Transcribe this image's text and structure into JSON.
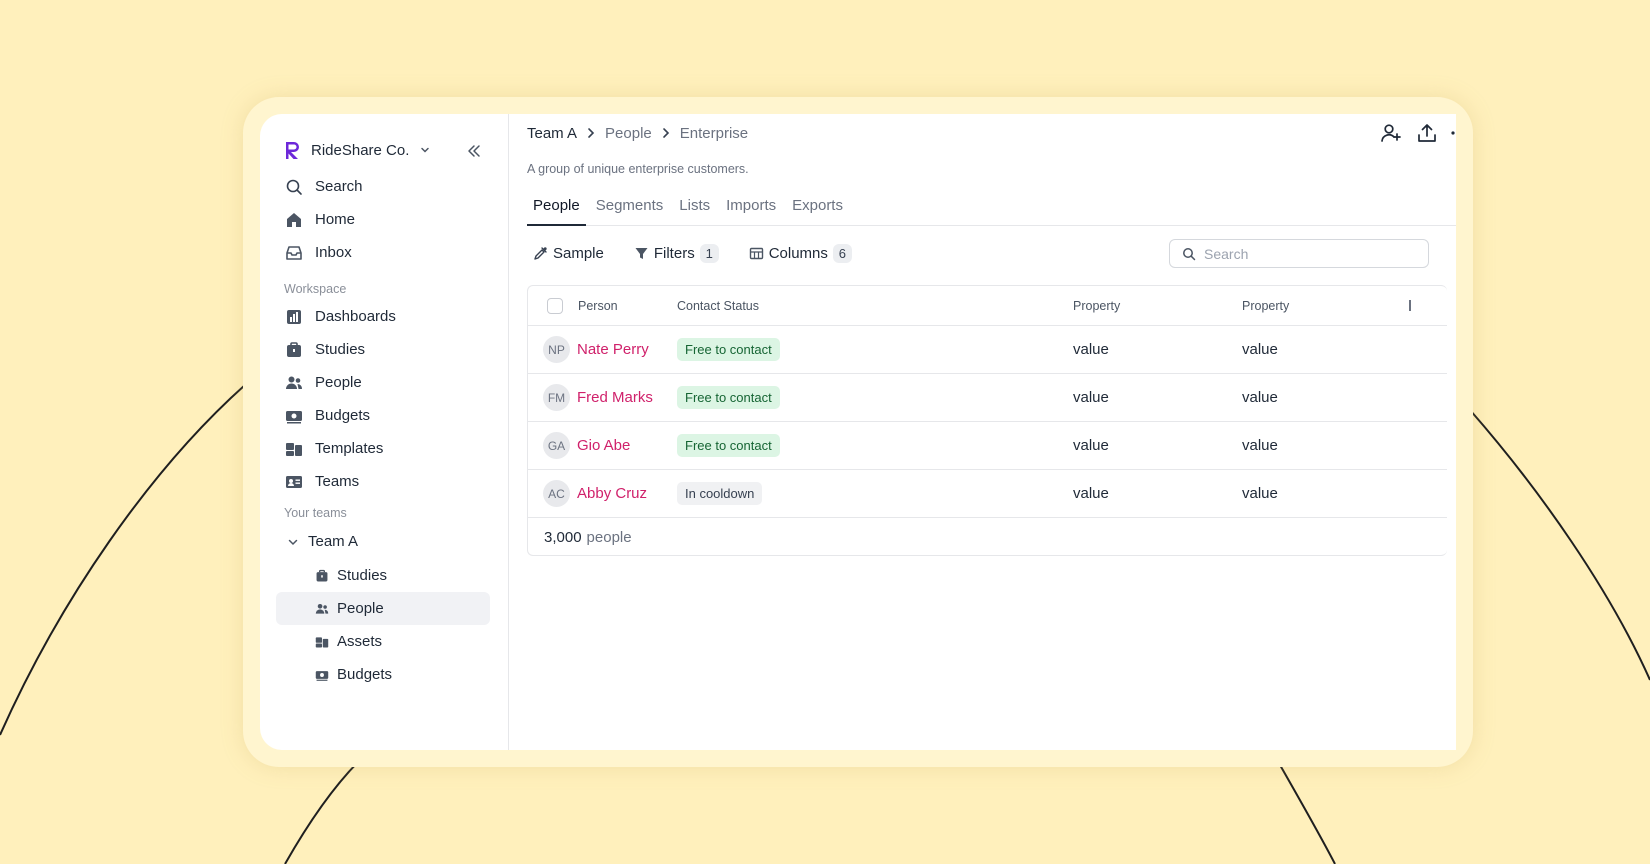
{
  "brand": {
    "name": "RideShare Co."
  },
  "nav_main": [
    {
      "label": "Search",
      "icon": "search-icon"
    },
    {
      "label": "Home",
      "icon": "home-icon"
    },
    {
      "label": "Inbox",
      "icon": "inbox-icon"
    }
  ],
  "workspace": {
    "label": "Workspace",
    "items": [
      {
        "label": "Dashboards",
        "icon": "chart-icon"
      },
      {
        "label": "Studies",
        "icon": "briefcase-icon"
      },
      {
        "label": "People",
        "icon": "people-icon"
      },
      {
        "label": "Budgets",
        "icon": "money-icon"
      },
      {
        "label": "Templates",
        "icon": "templates-icon"
      },
      {
        "label": "Teams",
        "icon": "id-card-icon"
      }
    ]
  },
  "your_teams": {
    "label": "Your teams",
    "team": "Team A",
    "items": [
      {
        "label": "Studies",
        "icon": "briefcase-icon"
      },
      {
        "label": "People",
        "icon": "people-icon",
        "active": true
      },
      {
        "label": "Assets",
        "icon": "assets-icon"
      },
      {
        "label": "Budgets",
        "icon": "money-icon"
      }
    ]
  },
  "breadcrumb": [
    "Team A",
    "People",
    "Enterprise"
  ],
  "description": "A group of unique enterprise customers.",
  "tabs": [
    "People",
    "Segments",
    "Lists",
    "Imports",
    "Exports"
  ],
  "active_tab": "People",
  "toolbar": {
    "sample": "Sample",
    "filters": "Filters",
    "filters_count": "1",
    "columns": "Columns",
    "columns_count": "6"
  },
  "search": {
    "placeholder": "Search"
  },
  "table": {
    "headers": [
      "Person",
      "Contact Status",
      "Property",
      "Property"
    ],
    "rows": [
      {
        "initials": "NP",
        "name": "Nate Perry",
        "status": "Free to contact",
        "status_type": "free",
        "p1": "value",
        "p2": "value"
      },
      {
        "initials": "FM",
        "name": "Fred Marks",
        "status": "Free to contact",
        "status_type": "free",
        "p1": "value",
        "p2": "value"
      },
      {
        "initials": "GA",
        "name": "Gio Abe",
        "status": "Free to contact",
        "status_type": "free",
        "p1": "value",
        "p2": "value"
      },
      {
        "initials": "AC",
        "name": "Abby Cruz",
        "status": "In cooldown",
        "status_type": "cool",
        "p1": "value",
        "p2": "value"
      }
    ],
    "footer_count": "3,000",
    "footer_unit": "people"
  },
  "colors": {
    "background": "#fff0bc",
    "accent": "#6d28d9",
    "person_link": "#d0216b",
    "badge_free_bg": "#dcf5e4",
    "badge_free_text": "#166534"
  }
}
